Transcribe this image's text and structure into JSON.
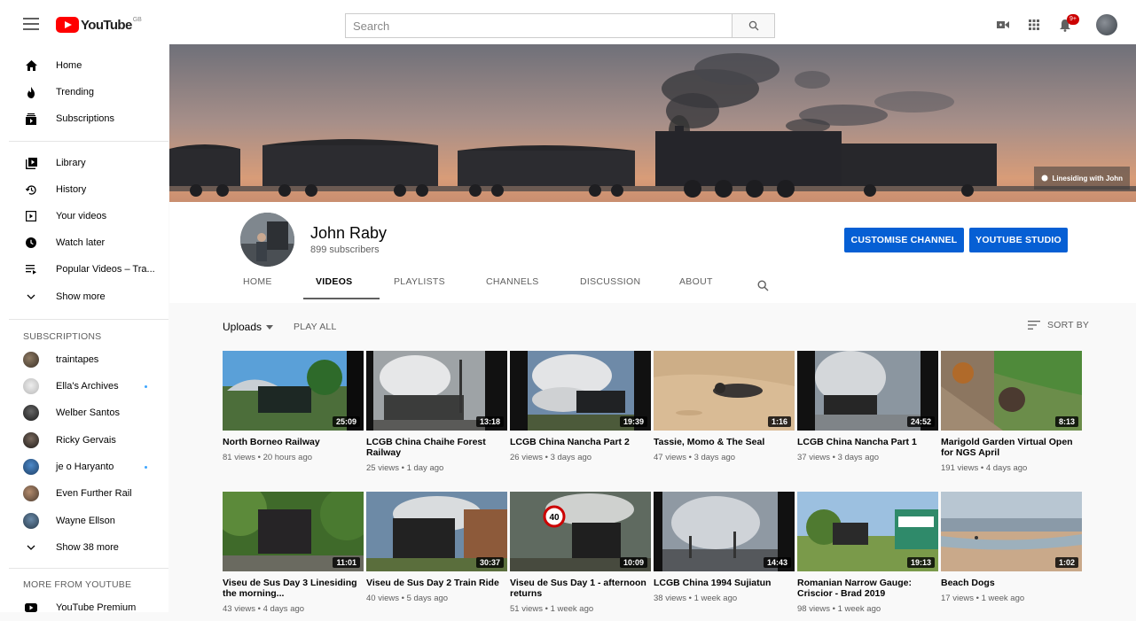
{
  "header": {
    "logo_text": "YouTube",
    "logo_region": "GB",
    "search_placeholder": "Search",
    "notification_count": "9+",
    "icons": [
      "menu-icon",
      "search-icon",
      "create-video-icon",
      "apps-grid-icon",
      "bell-icon",
      "account-avatar"
    ]
  },
  "sidebar": {
    "main": [
      {
        "label": "Home",
        "icon": "home-icon"
      },
      {
        "label": "Trending",
        "icon": "flame-icon"
      },
      {
        "label": "Subscriptions",
        "icon": "subscriptions-icon"
      }
    ],
    "library": [
      {
        "label": "Library",
        "icon": "library-icon"
      },
      {
        "label": "History",
        "icon": "history-icon"
      },
      {
        "label": "Your videos",
        "icon": "your-videos-icon"
      },
      {
        "label": "Watch later",
        "icon": "clock-icon"
      },
      {
        "label": "Popular Videos – Tra...",
        "icon": "playlist-icon"
      },
      {
        "label": "Show more",
        "icon": "chevron-down-icon"
      }
    ],
    "subscriptions_heading": "SUBSCRIPTIONS",
    "subscriptions": [
      {
        "label": "traintapes",
        "dot": false
      },
      {
        "label": "Ella's Archives",
        "dot": true
      },
      {
        "label": "Welber Santos",
        "dot": false
      },
      {
        "label": "Ricky Gervais",
        "dot": false
      },
      {
        "label": "je o Haryanto",
        "dot": true
      },
      {
        "label": "Even Further Rail",
        "dot": false
      },
      {
        "label": "Wayne Ellson",
        "dot": false
      },
      {
        "label": "Show 38 more",
        "dot": false
      }
    ],
    "more_heading": "MORE FROM YOUTUBE",
    "more": [
      {
        "label": "YouTube Premium",
        "icon": "youtube-premium-icon"
      }
    ]
  },
  "banner": {
    "credit": "Linesiding with John"
  },
  "channel": {
    "name": "John Raby",
    "subscribers": "899 subscribers",
    "customise_label": "CUSTOMISE CHANNEL",
    "studio_label": "YOUTUBE STUDIO",
    "tabs": [
      "HOME",
      "VIDEOS",
      "PLAYLISTS",
      "CHANNELS",
      "DISCUSSION",
      "ABOUT"
    ],
    "active_tab": "VIDEOS"
  },
  "videos_toolbar": {
    "uploads_label": "Uploads",
    "play_all_label": "PLAY ALL",
    "sort_label": "SORT BY"
  },
  "videos": [
    {
      "title": "North Borneo Railway",
      "meta": "81 views • 20 hours ago",
      "duration": "25:09"
    },
    {
      "title": "LCGB China Chaihe Forest Railway",
      "meta": "25 views • 1 day ago",
      "duration": "13:18"
    },
    {
      "title": "LCGB China Nancha Part 2",
      "meta": "26 views • 3 days ago",
      "duration": "19:39"
    },
    {
      "title": "Tassie, Momo & The Seal",
      "meta": "47 views • 3 days ago",
      "duration": "1:16"
    },
    {
      "title": "LCGB China Nancha Part 1",
      "meta": "37 views • 3 days ago",
      "duration": "24:52"
    },
    {
      "title": "Marigold Garden Virtual Open for NGS April",
      "meta": "191 views • 4 days ago",
      "duration": "8:13"
    },
    {
      "title": "Viseu de Sus Day 3 Linesiding the morning...",
      "meta": "43 views • 4 days ago",
      "duration": "11:01"
    },
    {
      "title": "Viseu de Sus Day 2 Train Ride",
      "meta": "40 views • 5 days ago",
      "duration": "30:37"
    },
    {
      "title": "Viseu de Sus Day 1 - afternoon returns",
      "meta": "51 views • 1 week ago",
      "duration": "10:09"
    },
    {
      "title": "LCGB China 1994 Sujiatun",
      "meta": "38 views • 1 week ago",
      "duration": "14:43"
    },
    {
      "title": "Romanian Narrow Gauge: Criscior - Brad 2019",
      "meta": "98 views • 1 week ago",
      "duration": "19:13"
    },
    {
      "title": "Beach Dogs",
      "meta": "17 views • 1 week ago",
      "duration": "1:02"
    }
  ]
}
